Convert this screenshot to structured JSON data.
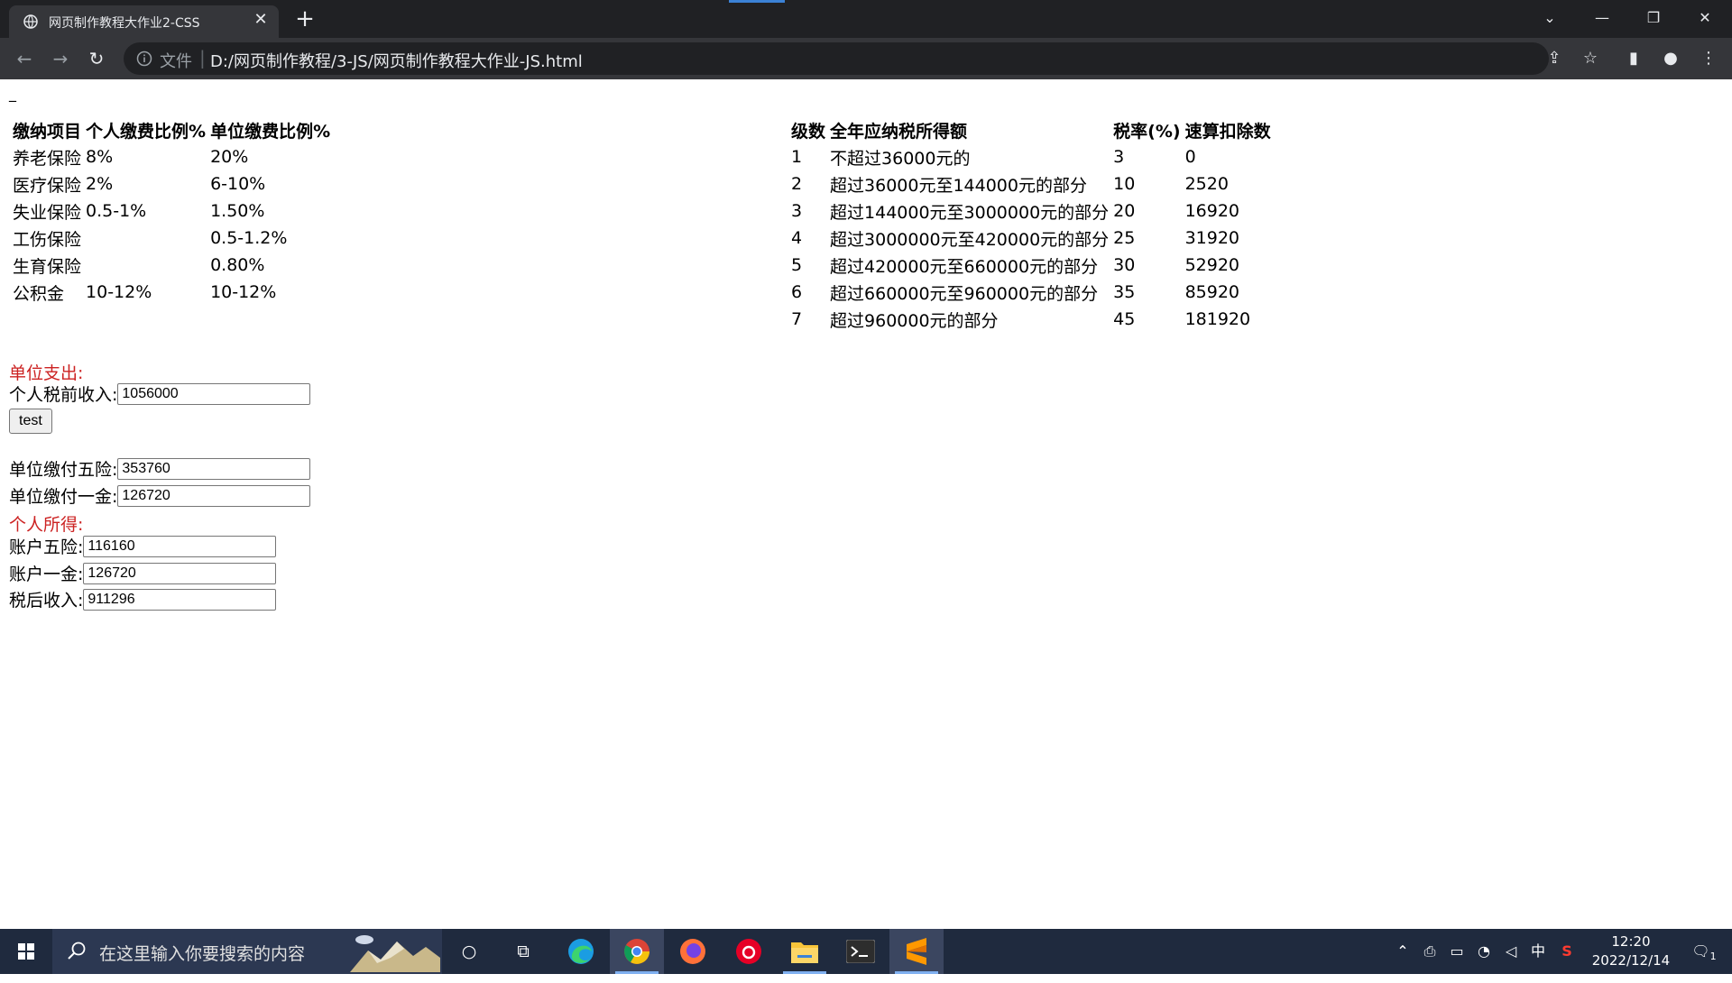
{
  "browser": {
    "tab_title": "网页制作教程大作业2-CSS",
    "tab_close": "✕",
    "new_tab": "+",
    "scheme_label": "文件",
    "separator": "|",
    "url": "D:/网页制作教程/3-JS/网页制作教程大作业-JS.html",
    "window_controls": [
      "⌄",
      "—",
      "❐",
      "✕"
    ]
  },
  "page": {
    "stray_text": "_",
    "insurance_table": {
      "headers": [
        "缴纳项目",
        "个人缴费比例%",
        "单位缴费比例%"
      ],
      "rows": [
        [
          "养老保险",
          "8%",
          "20%"
        ],
        [
          "医疗保险",
          "2%",
          "6-10%"
        ],
        [
          "失业保险",
          "0.5-1%",
          "1.50%"
        ],
        [
          "工伤保险",
          "",
          "0.5-1.2%"
        ],
        [
          "生育保险",
          "",
          "0.80%"
        ],
        [
          "公积金",
          "10-12%",
          "10-12%"
        ]
      ]
    },
    "tax_table": {
      "headers": [
        "级数",
        "全年应纳税所得额",
        "税率(%)",
        "速算扣除数"
      ],
      "rows": [
        [
          "1",
          "不超过36000元的",
          "3",
          "0"
        ],
        [
          "2",
          "超过36000元至144000元的部分",
          "10",
          "2520"
        ],
        [
          "3",
          "超过144000元至3000000元的部分",
          "20",
          "16920"
        ],
        [
          "4",
          "超过3000000元至420000元的部分",
          "25",
          "31920"
        ],
        [
          "5",
          "超过420000元至660000元的部分",
          "30",
          "52920"
        ],
        [
          "6",
          "超过660000元至960000元的部分",
          "35",
          "85920"
        ],
        [
          "7",
          "超过960000元的部分",
          "45",
          "181920"
        ]
      ]
    },
    "unit_section": {
      "heading": "单位支出:",
      "pretax_label": "个人税前收入:",
      "pretax_value": "1056000",
      "test_button": "test",
      "five_insurance_label": "单位缴付五险:",
      "five_insurance_value": "353760",
      "housing_fund_label": "单位缴付一金:",
      "housing_fund_value": "126720"
    },
    "personal_section": {
      "heading": "个人所得:",
      "account_five_label": "账户五险:",
      "account_five_value": "116160",
      "account_fund_label": "账户一金:",
      "account_fund_value": "126720",
      "after_tax_label": "税后收入:",
      "after_tax_value": "911296"
    }
  },
  "taskbar": {
    "search_placeholder": "在这里输入你要搜索的内容",
    "ime_label": "中",
    "time": "12:20",
    "date": "2022/12/14",
    "notification_count": "1"
  },
  "colors": {
    "tabbar_bg": "#202124",
    "toolbar_bg": "#35363a",
    "heading_red": "#cc2222",
    "taskbar_bg": "#1f2a3e"
  }
}
